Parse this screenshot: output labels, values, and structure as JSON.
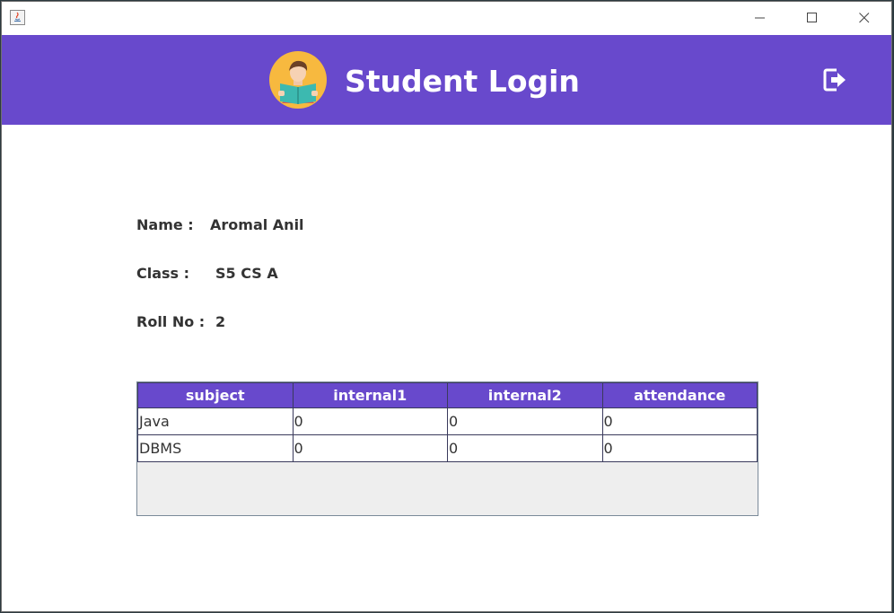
{
  "window": {
    "app_icon": "java-icon",
    "controls": [
      "minimize-icon",
      "maximize-icon",
      "close-icon"
    ]
  },
  "header": {
    "title": "Student Login",
    "avatar_icon": "student-reading-avatar",
    "logout_icon": "logout-icon",
    "bg_color": "#6849cc"
  },
  "student": {
    "name_label": "Name :",
    "name_value": "Aromal Anil",
    "class_label": "Class   :",
    "class_value": "S5 CS A",
    "roll_label": "Roll No :",
    "roll_value": "2"
  },
  "table": {
    "headers": [
      "subject",
      "internal1",
      "internal2",
      "attendance"
    ],
    "rows": [
      [
        "Java",
        "0",
        "0",
        "0"
      ],
      [
        "DBMS",
        "0",
        "0",
        "0"
      ]
    ]
  }
}
